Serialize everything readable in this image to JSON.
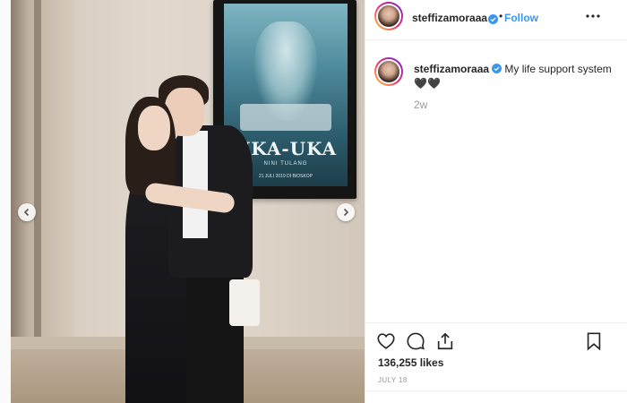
{
  "post": {
    "username": "steffizamoraaa",
    "follow_label": "Follow",
    "separator": "•",
    "caption": "My life support system🖤🖤",
    "time_ago": "2w",
    "likes": "136,255 likes",
    "date": "JULY 18",
    "verified": true
  },
  "poster": {
    "title": "UKA-UKA",
    "subtitle": "NINI TULANG",
    "date_line": "21 JULI 2019 DI BIOSKOP"
  },
  "colors": {
    "link": "#3897f0",
    "verified": "#3897f0",
    "text": "#262626",
    "muted": "#999999",
    "border": "#efefef"
  },
  "icons": {
    "prev": "chevron-left-icon",
    "next": "chevron-right-icon",
    "more": "more-horizontal-icon",
    "like": "heart-icon",
    "comment": "comment-icon",
    "share": "share-icon",
    "save": "bookmark-icon",
    "verified": "verified-badge-icon"
  }
}
